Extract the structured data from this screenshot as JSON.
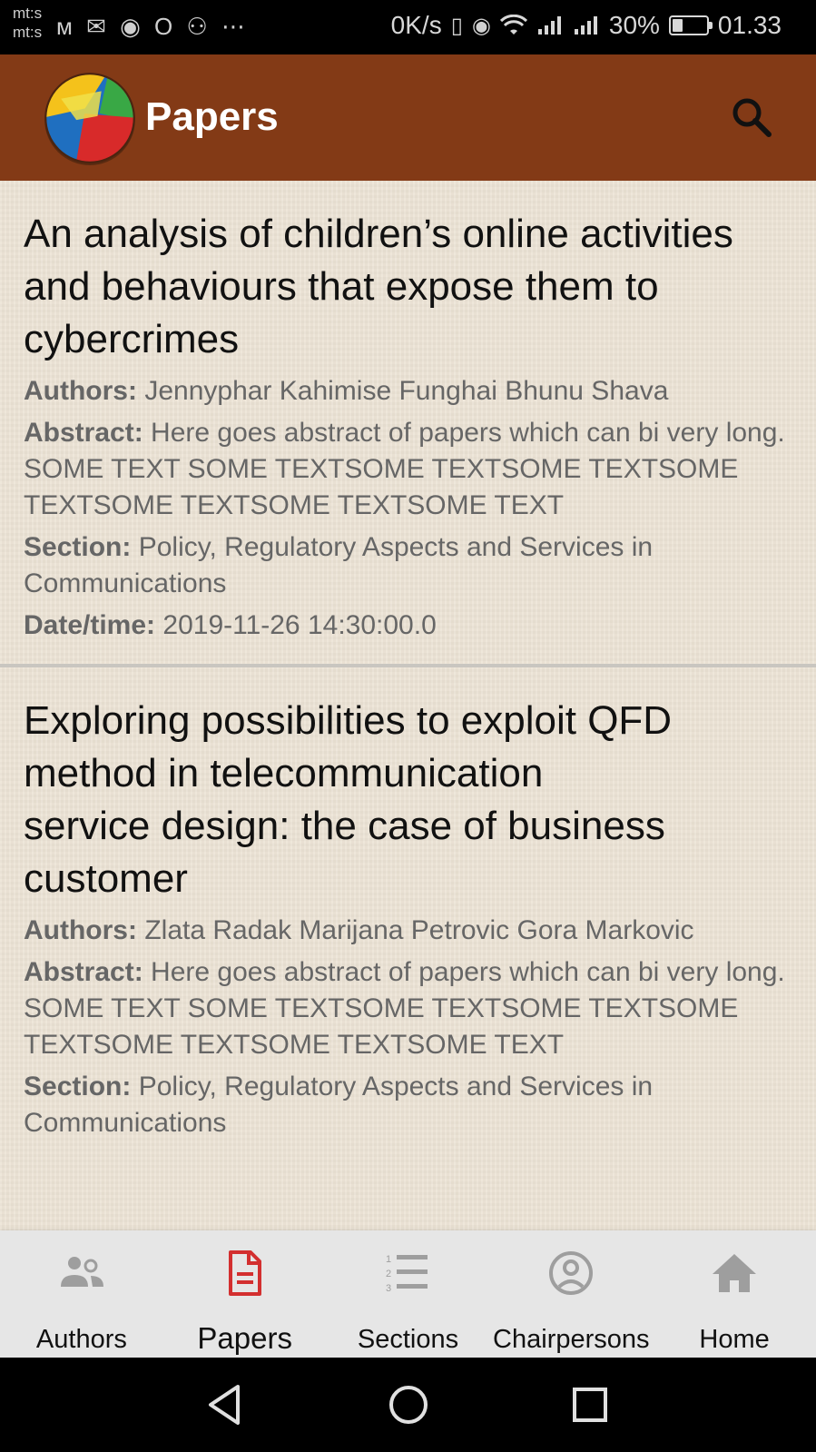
{
  "status_bar": {
    "carrier_line1": "mt:s",
    "carrier_line2": "mt:s",
    "notification_icons": "ᴍ ✉ ◉ O ⚇ ⋯",
    "net_speed": "0K/s",
    "battery_percent": "30%",
    "battery_level": 0.3,
    "time": "01.33"
  },
  "app_bar": {
    "title": "Papers",
    "brand_color": "#833a16"
  },
  "papers": [
    {
      "title": "An analysis of children’s online activities and behaviours that expose them to cybercrimes",
      "authors_label": "Authors:",
      "authors": "Jennyphar Kahimise Funghai Bhunu Shava",
      "abstract_label": "Abstract:",
      "abstract": "Here goes abstract of papers which can bi very long. SOME TEXT SOME TEXTSOME TEXTSOME TEXTSOME TEXTSOME TEXTSOME TEXTSOME TEXT",
      "section_label": "Section:",
      "section": "Policy, Regulatory Aspects and Services in Communications",
      "datetime_label": "Date/time:",
      "datetime": "2019-11-26 14:30:00.0"
    },
    {
      "title": " Exploring possibilities to exploit QFD\nmethod in telecommunication\nservice design: the case of business\ncustomer",
      "authors_label": "Authors:",
      "authors": "Zlata Radak Marijana Petrovic Gora Markovic",
      "abstract_label": "Abstract:",
      "abstract": "Here goes abstract of papers which can bi very long. SOME TEXT SOME TEXTSOME TEXTSOME TEXTSOME TEXTSOME TEXTSOME TEXTSOME TEXT",
      "section_label": "Section:",
      "section": "Policy, Regulatory Aspects and Services in Communications"
    }
  ],
  "bottom_nav": {
    "items": [
      {
        "label": "Authors",
        "icon": "people-icon"
      },
      {
        "label": "Papers",
        "icon": "document-icon",
        "active": true
      },
      {
        "label": "Sections",
        "icon": "numbered-list-icon"
      },
      {
        "label": "Chairpersons",
        "icon": "person-circle-icon"
      },
      {
        "label": "Home",
        "icon": "home-icon"
      }
    ],
    "active_color": "#d32f2f",
    "inactive_icon_color": "#9e9e9e"
  }
}
